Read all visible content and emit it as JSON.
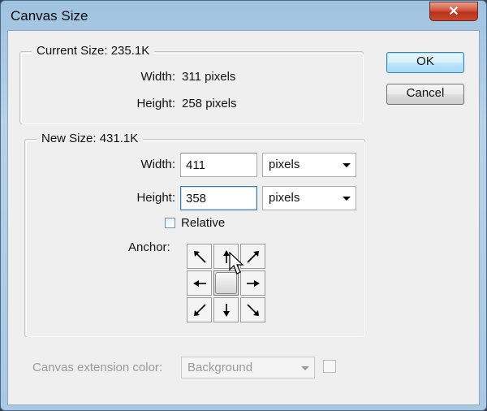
{
  "window": {
    "title": "Canvas Size",
    "close_glyph": "✕"
  },
  "buttons": {
    "ok": "OK",
    "cancel": "Cancel"
  },
  "current_size": {
    "legend": "Current Size: 235.1K",
    "width_label": "Width:",
    "width_value": "311 pixels",
    "height_label": "Height:",
    "height_value": "258 pixels"
  },
  "new_size": {
    "legend": "New Size: 431.1K",
    "width_label": "Width:",
    "width_value": "411",
    "width_unit": "pixels",
    "height_label": "Height:",
    "height_value": "358",
    "height_unit": "pixels",
    "relative_label": "Relative",
    "relative_checked": false,
    "anchor_label": "Anchor:"
  },
  "extension": {
    "label": "Canvas extension color:",
    "value": "Background"
  },
  "icons": {
    "close": "close-icon",
    "dropdown": "chevron-down-icon",
    "anchor_arrows": [
      "arrow-nw",
      "arrow-n",
      "arrow-ne",
      "arrow-w",
      "anchor-center",
      "arrow-e",
      "arrow-sw",
      "arrow-s",
      "arrow-se"
    ],
    "cursor": "mouse-pointer-icon"
  }
}
